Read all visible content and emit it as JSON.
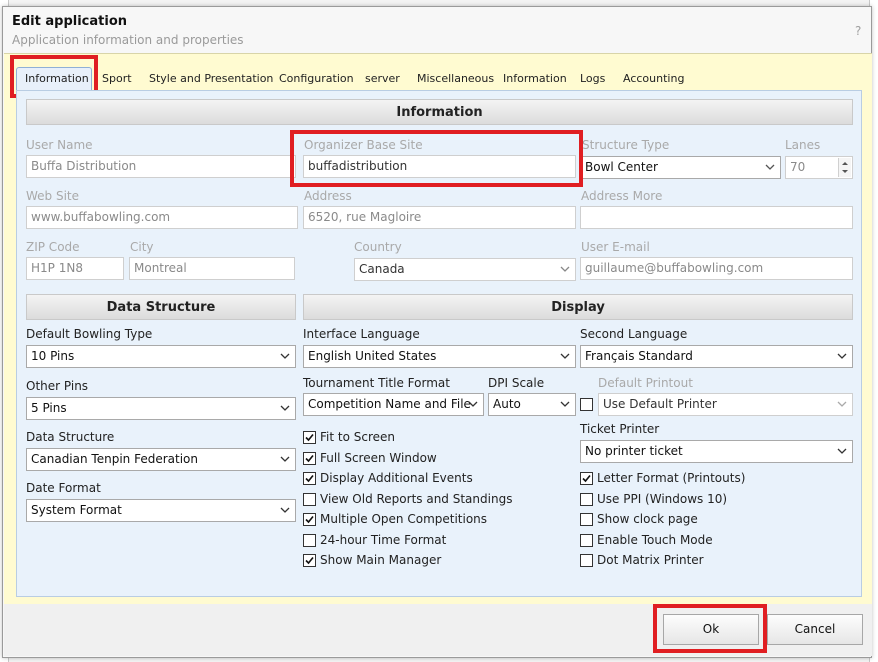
{
  "window": {
    "title": "Edit application",
    "subtitle": "Application information and properties",
    "help": "?"
  },
  "tabs": [
    "Information",
    "Sport",
    "Style and Presentation",
    "Configuration",
    "server",
    "Miscellaneous",
    "Information",
    "Logs",
    "Accounting"
  ],
  "active_tab": "Information",
  "information": {
    "header": "Information",
    "user_name": {
      "label": "User Name",
      "value": "Buffa Distribution"
    },
    "organizer_base_site": {
      "label": "Organizer Base Site",
      "value": "buffadistribution"
    },
    "structure_type": {
      "label": "Structure Type",
      "value": "Bowl Center"
    },
    "lanes": {
      "label": "Lanes",
      "value": "70"
    },
    "web_site": {
      "label": "Web Site",
      "value": "www.buffabowling.com"
    },
    "address": {
      "label": "Address",
      "value": "6520, rue Magloire"
    },
    "address_more": {
      "label": "Address More",
      "value": ""
    },
    "zip_code": {
      "label": "ZIP Code",
      "value": "H1P 1N8"
    },
    "city": {
      "label": "City",
      "value": "Montreal"
    },
    "country": {
      "label": "Country",
      "value": "Canada"
    },
    "user_email": {
      "label": "User E-mail",
      "value": "guillaume@buffabowling.com"
    }
  },
  "data_structure": {
    "header": "Data Structure",
    "default_bowling_type": {
      "label": "Default Bowling Type",
      "value": "10 Pins"
    },
    "other_pins": {
      "label": "Other Pins",
      "value": "5 Pins"
    },
    "data_structure": {
      "label": "Data Structure",
      "value": "Canadian Tenpin Federation"
    },
    "date_format": {
      "label": "Date Format",
      "value": "System Format"
    }
  },
  "display": {
    "header": "Display",
    "interface_language": {
      "label": "Interface Language",
      "value": "English United States"
    },
    "second_language": {
      "label": "Second Language",
      "value": "Français Standard"
    },
    "tournament_title_format": {
      "label": "Tournament Title Format",
      "value": "Competition Name and File"
    },
    "dpi_scale": {
      "label": "DPI Scale",
      "value": "Auto"
    },
    "default_printout": {
      "label": "Default Printout",
      "value": "Use Default Printer",
      "checked": false
    },
    "ticket_printer": {
      "label": "Ticket Printer",
      "value": "No printer ticket"
    },
    "checks_left": [
      {
        "label": "Fit to Screen",
        "checked": true
      },
      {
        "label": "Full Screen Window",
        "checked": true
      },
      {
        "label": "Display Additional Events",
        "checked": true
      },
      {
        "label": "View Old Reports and Standings",
        "checked": false
      },
      {
        "label": "Multiple Open Competitions",
        "checked": true
      },
      {
        "label": "24-hour Time Format",
        "checked": false
      },
      {
        "label": "Show Main Manager",
        "checked": true
      }
    ],
    "checks_right": [
      {
        "label": "Letter Format (Printouts)",
        "checked": true
      },
      {
        "label": "Use PPI (Windows 10)",
        "checked": false
      },
      {
        "label": "Show clock page",
        "checked": false
      },
      {
        "label": "Enable Touch Mode",
        "checked": false
      },
      {
        "label": "Dot Matrix Printer",
        "checked": false
      }
    ]
  },
  "buttons": {
    "ok": "Ok",
    "cancel": "Cancel"
  },
  "colors": {
    "highlight": "#e01e22",
    "panel": "#e9f2fb",
    "tabbar": "#fffbd1"
  },
  "icons": {
    "dropdown": "chevron-down-icon",
    "check": "checkmark-icon"
  }
}
